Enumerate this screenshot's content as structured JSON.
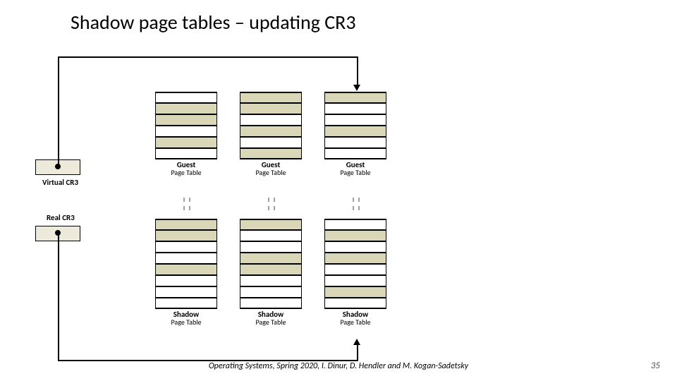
{
  "title": "Shadow page tables – updating CR3",
  "labels": {
    "virtual_cr3": "Virtual CR3",
    "real_cr3": "Real CR3"
  },
  "guest_cols": [
    {
      "title": "Guest",
      "subtitle": "Page Table"
    },
    {
      "title": "Guest",
      "subtitle": "Page Table"
    },
    {
      "title": "Guest",
      "subtitle": "Page Table"
    }
  ],
  "shadow_cols": [
    {
      "title": "Shadow",
      "subtitle": "Page Table"
    },
    {
      "title": "Shadow",
      "subtitle": "Page Table"
    },
    {
      "title": "Shadow",
      "subtitle": "Page Table"
    }
  ],
  "footer": "Operating Systems, Spring 2020, I. Dinur, D. Hendler and M. Kogan-Sadetsky",
  "page": "35"
}
